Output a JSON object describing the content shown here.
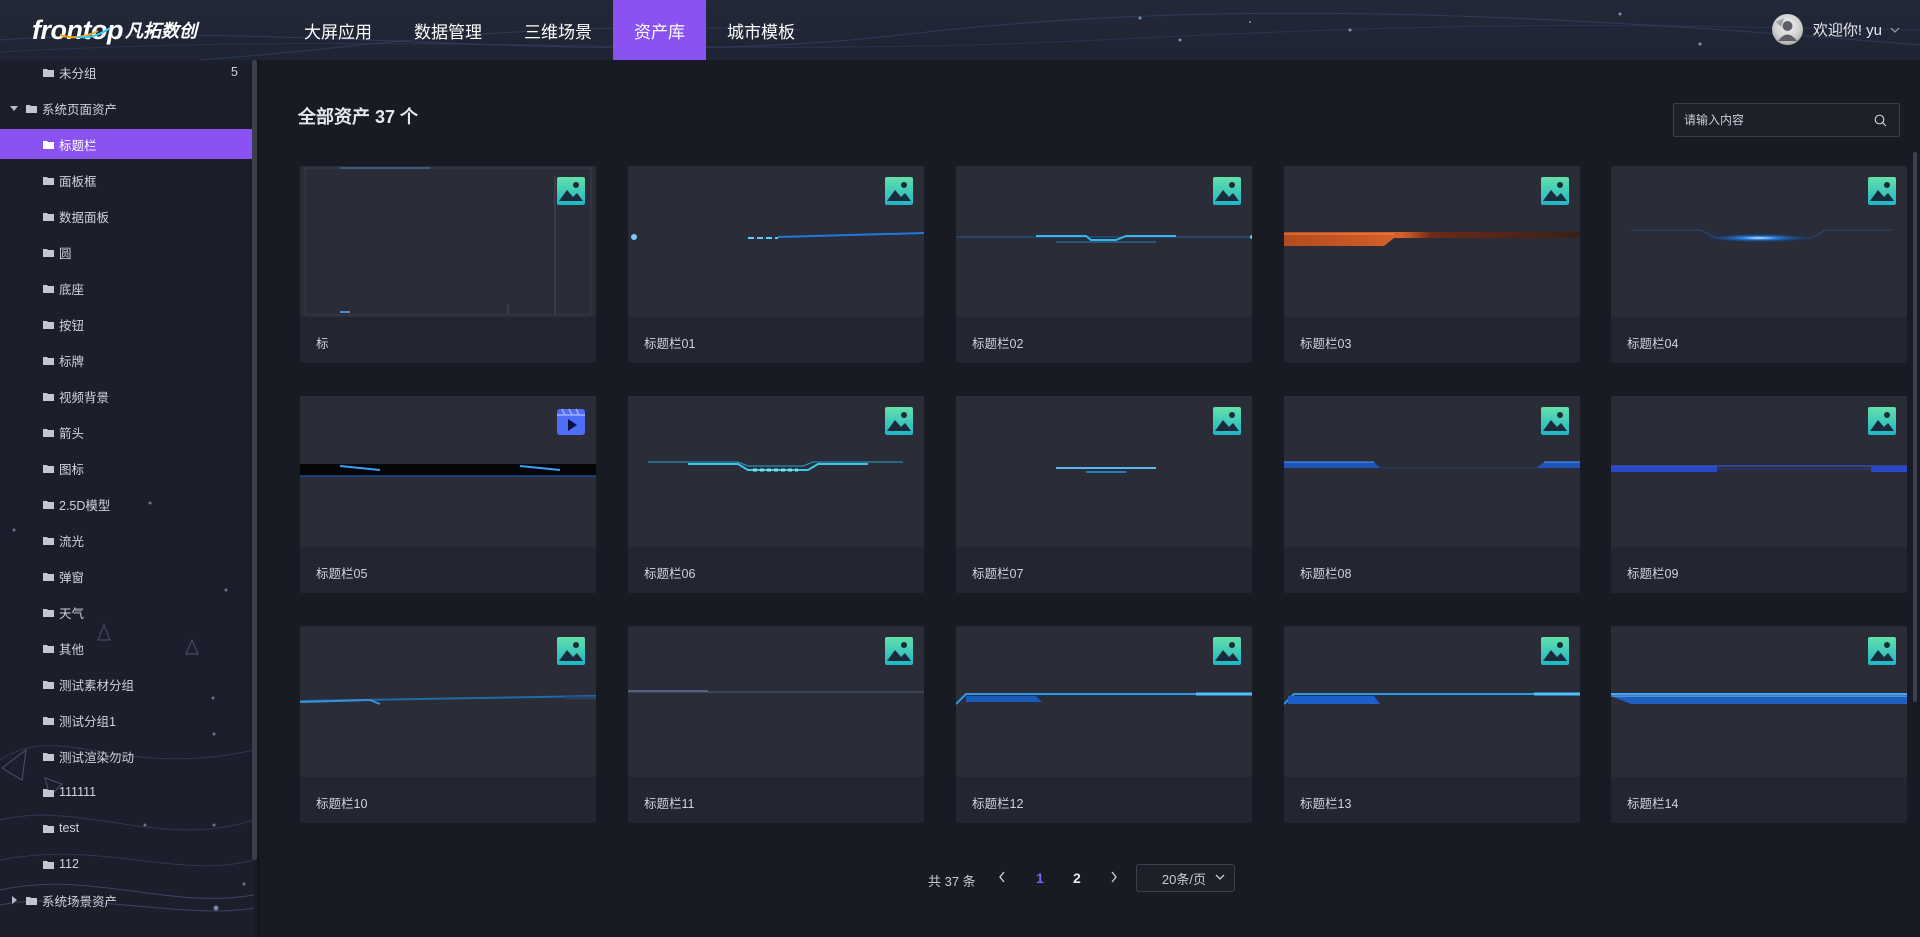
{
  "header": {
    "logo_en": "frontop",
    "logo_cn": "凡拓数创",
    "nav": [
      {
        "label": "大屏应用",
        "active": false
      },
      {
        "label": "数据管理",
        "active": false
      },
      {
        "label": "三维场景",
        "active": false
      },
      {
        "label": "资产库",
        "active": true
      },
      {
        "label": "城市模板",
        "active": false
      }
    ],
    "welcome": "欢迎你! yu"
  },
  "sidebar": {
    "items": [
      {
        "label": "未分组",
        "level": 2,
        "count": "5"
      },
      {
        "label": "系统页面资产",
        "level": 1,
        "expanded": true
      },
      {
        "label": "标题栏",
        "level": 2,
        "active": true
      },
      {
        "label": "面板框",
        "level": 2
      },
      {
        "label": "数据面板",
        "level": 2
      },
      {
        "label": "圆",
        "level": 2
      },
      {
        "label": "底座",
        "level": 2
      },
      {
        "label": "按钮",
        "level": 2
      },
      {
        "label": "标牌",
        "level": 2
      },
      {
        "label": "视频背景",
        "level": 2
      },
      {
        "label": "箭头",
        "level": 2
      },
      {
        "label": "图标",
        "level": 2
      },
      {
        "label": "2.5D模型",
        "level": 2
      },
      {
        "label": "流光",
        "level": 2
      },
      {
        "label": "弹窗",
        "level": 2
      },
      {
        "label": "天气",
        "level": 2
      },
      {
        "label": "其他",
        "level": 2
      },
      {
        "label": "测试素材分组",
        "level": 2
      },
      {
        "label": "测试分组1",
        "level": 2
      },
      {
        "label": "测试渲染勿动",
        "level": 2
      },
      {
        "label": "111111",
        "level": 2
      },
      {
        "label": "test",
        "level": 2
      },
      {
        "label": "112",
        "level": 2
      },
      {
        "label": "系统场景资产",
        "level": 1,
        "expanded": false
      }
    ]
  },
  "main": {
    "title": "全部资产 37 个",
    "search_placeholder": "请输入内容"
  },
  "cards": [
    {
      "label": "标",
      "type": "image-icon"
    },
    {
      "label": "标题栏01",
      "type": "image-icon"
    },
    {
      "label": "标题栏02",
      "type": "image-icon"
    },
    {
      "label": "标题栏03",
      "type": "image-icon"
    },
    {
      "label": "标题栏04",
      "type": "image-icon"
    },
    {
      "label": "标题栏05",
      "type": "video-icon"
    },
    {
      "label": "标题栏06",
      "type": "image-icon"
    },
    {
      "label": "标题栏07",
      "type": "image-icon"
    },
    {
      "label": "标题栏08",
      "type": "image-icon"
    },
    {
      "label": "标题栏09",
      "type": "image-icon"
    },
    {
      "label": "标题栏10",
      "type": "image-icon"
    },
    {
      "label": "标题栏11",
      "type": "image-icon"
    },
    {
      "label": "标题栏12",
      "type": "image-icon"
    },
    {
      "label": "标题栏13",
      "type": "image-icon"
    },
    {
      "label": "标题栏14",
      "type": "image-icon"
    }
  ],
  "pagination": {
    "total": "共 37 条",
    "pages": [
      "1",
      "2"
    ],
    "current": "1",
    "page_size": "20条/页"
  },
  "colors": {
    "accent": "#8a52f0",
    "page_current": "#7d63f7",
    "background": "#181b24"
  }
}
